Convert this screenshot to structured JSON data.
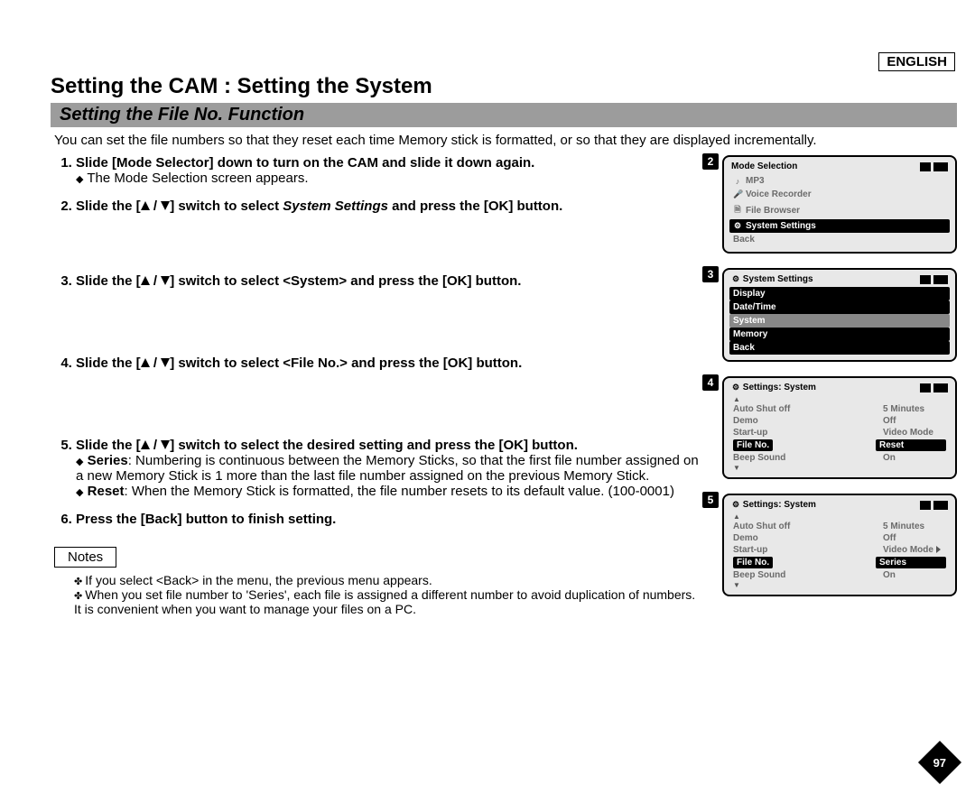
{
  "lang": "ENGLISH",
  "title": "Setting the CAM : Setting the System",
  "subtitle": "Setting the File No. Function",
  "intro": "You can set the file numbers so that they reset each time Memory stick is formatted, or so that they are displayed incrementally.",
  "steps": {
    "s1": {
      "text": "Slide [Mode Selector] down to turn on the CAM and slide it down again.",
      "sub": "The Mode Selection screen appears."
    },
    "s2": {
      "pre": "Slide the [",
      "mid": "] switch to select ",
      "ital": "System Settings",
      "post": " and press the [OK] button."
    },
    "s3": {
      "pre": "Slide the [",
      "post": "] switch to select <System> and press the [OK] button."
    },
    "s4": {
      "pre": "Slide the [",
      "post": "] switch to select <File No.> and press the [OK] button."
    },
    "s5": {
      "pre": "Slide the [",
      "post": "] switch to select the desired setting and press the [OK] button.",
      "sub1_lead": "Series",
      "sub1_text": ": Numbering is continuous between the Memory Sticks, so that the first file number assigned on a new Memory Stick is 1 more than the last file number assigned on the previous Memory Stick.",
      "sub2_lead": "Reset",
      "sub2_text": ": When the Memory Stick is formatted, the file number resets to its default value. (100-0001)"
    },
    "s6": {
      "text": "Press the [Back] button to finish setting."
    }
  },
  "notes_label": "Notes",
  "notes": {
    "n1": "If you select <Back> in the menu, the previous menu appears.",
    "n2": "When you set file number to 'Series', each file is assigned a different number to avoid duplication of numbers. It is convenient when you want to manage your files on a PC."
  },
  "screens": {
    "sc2": {
      "num": "2",
      "head": "Mode Selection",
      "items": [
        "MP3",
        "Voice Recorder",
        "File Browser",
        "System Settings",
        "Back"
      ],
      "sel": 3
    },
    "sc3": {
      "num": "3",
      "head": "System Settings",
      "items": [
        "Display",
        "Date/Time",
        "System",
        "Memory",
        "Back"
      ],
      "sel": 2
    },
    "sc4": {
      "num": "4",
      "head": "Settings: System",
      "rows": [
        {
          "k": "Auto Shut off",
          "v": "5 Minutes"
        },
        {
          "k": "Demo",
          "v": "Off"
        },
        {
          "k": "Start-up",
          "v": "Video Mode"
        },
        {
          "k": "File No.",
          "v": "Reset"
        },
        {
          "k": "Beep Sound",
          "v": "On"
        }
      ],
      "sel": 3
    },
    "sc5": {
      "num": "5",
      "head": "Settings: System",
      "rows": [
        {
          "k": "Auto Shut off",
          "v": "5 Minutes"
        },
        {
          "k": "Demo",
          "v": "Off"
        },
        {
          "k": "Start-up",
          "v": "Video Mode"
        },
        {
          "k": "File No.",
          "v": "Series"
        },
        {
          "k": "Beep Sound",
          "v": "On"
        }
      ],
      "sel": 3
    }
  },
  "page_number": "97"
}
